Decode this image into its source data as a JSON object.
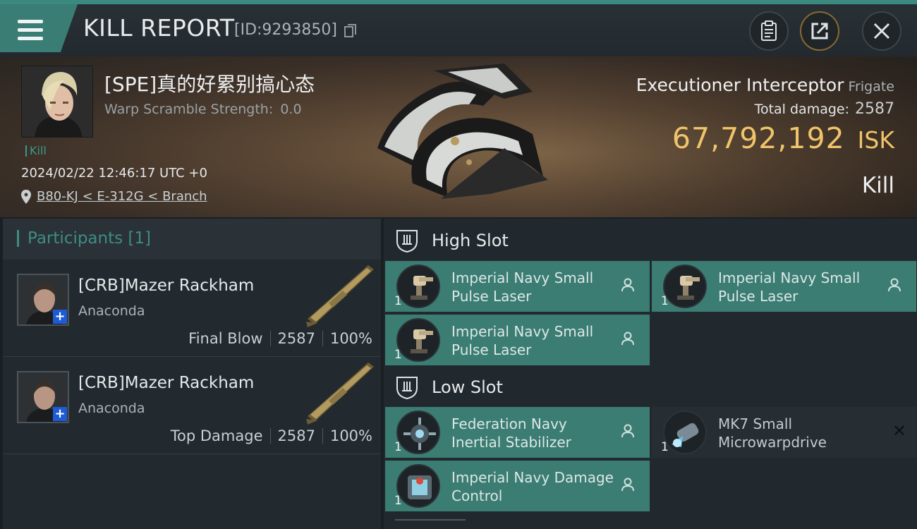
{
  "header": {
    "title": "KILL REPORT",
    "report_id": "[ID:9293850]"
  },
  "victim": {
    "name": "[SPE]真的好累别搞心态",
    "warp_label": "Warp Scramble Strength:",
    "warp_value": "0.0",
    "kill_tag": "Kill",
    "datetime": "2024/02/22 12:46:17 UTC +0",
    "location": "B80-KJ < E-312G < Branch"
  },
  "ship": {
    "name": "Executioner Interceptor",
    "class": "Frigate",
    "damage_label": "Total damage:",
    "damage_value": "2587",
    "isk_value": "67,792,192",
    "isk_unit": "ISK",
    "result": "Kill"
  },
  "participants": {
    "title": "Participants [1]",
    "rows": [
      {
        "name": "[CRB]Mazer Rackham",
        "ship": "Anaconda",
        "role": "Final Blow",
        "damage": "2587",
        "percent": "100%"
      },
      {
        "name": "[CRB]Mazer Rackham",
        "ship": "Anaconda",
        "role": "Top Damage",
        "damage": "2587",
        "percent": "100%"
      }
    ]
  },
  "slots": {
    "high": {
      "label": "High Slot",
      "modules": [
        {
          "name": "Imperial Navy Small Pulse Laser",
          "qty": "1"
        },
        {
          "name": "Imperial Navy Small Pulse Laser",
          "qty": "1"
        },
        {
          "name": "Imperial Navy Small Pulse Laser",
          "qty": "1"
        }
      ]
    },
    "low": {
      "label": "Low Slot",
      "modules": [
        {
          "name": "Federation Navy Inertial Stabilizer",
          "qty": "1"
        },
        {
          "name": "MK7 Small Microwarpdrive",
          "qty": "1"
        },
        {
          "name": "Imperial Navy Damage Control",
          "qty": "1"
        }
      ]
    }
  },
  "colors": {
    "accent": "#3b7d73",
    "isk": "#f0c46a",
    "plus_badge": "#1e5bd6"
  },
  "icons": [
    "menu-icon",
    "copy-icon",
    "clipboard-icon",
    "share-icon",
    "close-icon",
    "location-pin-icon",
    "slot-shield-icon",
    "person-icon",
    "x-icon"
  ]
}
